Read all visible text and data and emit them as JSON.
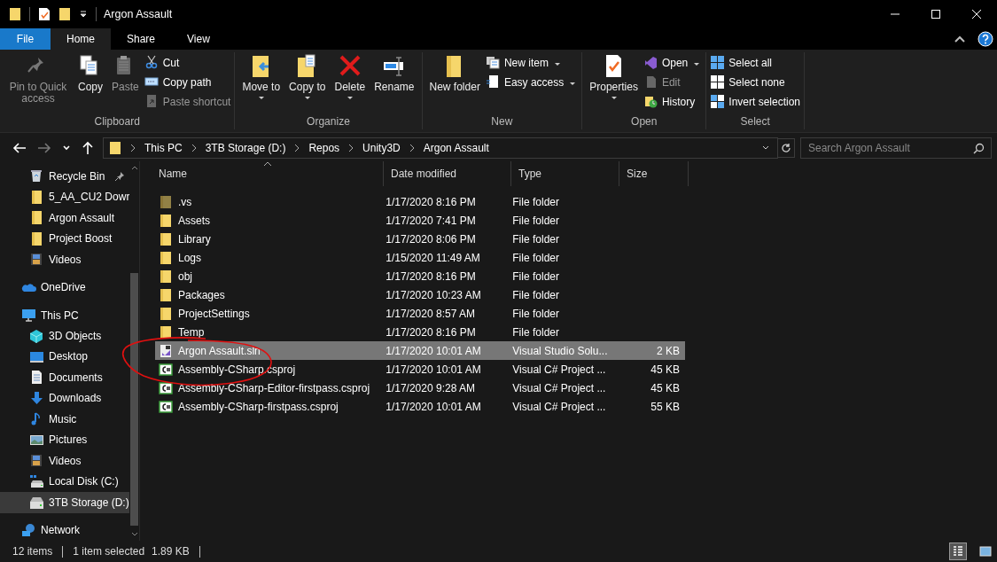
{
  "window": {
    "title": "Argon Assault"
  },
  "tabs": [
    {
      "label": "File",
      "kind": "file",
      "selected": false
    },
    {
      "label": "Home",
      "kind": "tab",
      "selected": true
    },
    {
      "label": "Share",
      "kind": "tab",
      "selected": false
    },
    {
      "label": "View",
      "kind": "tab",
      "selected": false
    }
  ],
  "ribbon": {
    "groups": [
      {
        "label": "Clipboard",
        "items": [
          {
            "label": "Pin to Quick access",
            "kind": "large",
            "disabled": true,
            "dropdown": false
          },
          {
            "label": "Copy",
            "kind": "large",
            "disabled": false,
            "dropdown": false
          },
          {
            "label": "Paste",
            "kind": "large",
            "disabled": true,
            "dropdown": false
          },
          {
            "label": "Cut",
            "kind": "small",
            "disabled": false,
            "dropdown": false
          },
          {
            "label": "Copy path",
            "kind": "small",
            "disabled": false,
            "dropdown": false
          },
          {
            "label": "Paste shortcut",
            "kind": "small",
            "disabled": true,
            "dropdown": false
          }
        ]
      },
      {
        "label": "Organize",
        "items": [
          {
            "label": "Move to",
            "kind": "large",
            "disabled": false,
            "dropdown": true
          },
          {
            "label": "Copy to",
            "kind": "large",
            "disabled": false,
            "dropdown": true
          },
          {
            "label": "Delete",
            "kind": "large",
            "disabled": false,
            "dropdown": true
          },
          {
            "label": "Rename",
            "kind": "large",
            "disabled": false,
            "dropdown": false
          }
        ]
      },
      {
        "label": "New",
        "items": [
          {
            "label": "New folder",
            "kind": "large",
            "disabled": false,
            "dropdown": false
          },
          {
            "label": "New item",
            "kind": "small",
            "disabled": false,
            "dropdown": true
          },
          {
            "label": "Easy access",
            "kind": "small",
            "disabled": false,
            "dropdown": true
          }
        ]
      },
      {
        "label": "Open",
        "items": [
          {
            "label": "Properties",
            "kind": "large",
            "disabled": false,
            "dropdown": true
          },
          {
            "label": "Open",
            "kind": "small",
            "disabled": false,
            "dropdown": true
          },
          {
            "label": "Edit",
            "kind": "small",
            "disabled": true,
            "dropdown": false
          },
          {
            "label": "History",
            "kind": "small",
            "disabled": false,
            "dropdown": false
          }
        ]
      },
      {
        "label": "Select",
        "items": [
          {
            "label": "Select all",
            "kind": "small",
            "disabled": false,
            "dropdown": false
          },
          {
            "label": "Select none",
            "kind": "small",
            "disabled": false,
            "dropdown": false
          },
          {
            "label": "Invert selection",
            "kind": "small",
            "disabled": false,
            "dropdown": false
          }
        ]
      }
    ]
  },
  "address": {
    "forward_disabled": true,
    "path": [
      "This PC",
      "3TB Storage (D:)",
      "Repos",
      "Unity3D",
      "Argon Assault"
    ],
    "search": {
      "placeholder": "Search Argon Assault"
    }
  },
  "sidebar": {
    "quick_access": [
      {
        "label": "Recycle Bin",
        "pinned": true,
        "selected": false
      },
      {
        "label": "5_AA_CU2 Dowr",
        "pinned": false,
        "selected": false
      },
      {
        "label": "Argon Assault",
        "pinned": false,
        "selected": false
      },
      {
        "label": "Project Boost",
        "pinned": false,
        "selected": false
      },
      {
        "label": "Videos",
        "pinned": false,
        "selected": false
      }
    ],
    "items": [
      {
        "label": "OneDrive",
        "selected": false
      },
      {
        "label": "This PC",
        "selected": false,
        "children": [
          {
            "label": "3D Objects",
            "selected": false
          },
          {
            "label": "Desktop",
            "selected": false
          },
          {
            "label": "Documents",
            "selected": false
          },
          {
            "label": "Downloads",
            "selected": false
          },
          {
            "label": "Music",
            "selected": false
          },
          {
            "label": "Pictures",
            "selected": false
          },
          {
            "label": "Videos",
            "selected": false
          },
          {
            "label": "Local Disk (C:)",
            "selected": false
          },
          {
            "label": "3TB Storage (D:)",
            "selected": true
          }
        ]
      },
      {
        "label": "Network",
        "selected": false
      }
    ]
  },
  "table": {
    "columns": [
      "Name",
      "Date modified",
      "Type",
      "Size"
    ],
    "rows": [
      {
        "kind": "folder",
        "hidden": true,
        "selected": false,
        "name": ".vs",
        "date": "1/17/2020 8:16 PM",
        "type": "File folder",
        "size": ""
      },
      {
        "kind": "folder",
        "hidden": false,
        "selected": false,
        "name": "Assets",
        "date": "1/17/2020 7:41 PM",
        "type": "File folder",
        "size": ""
      },
      {
        "kind": "folder",
        "hidden": false,
        "selected": false,
        "name": "Library",
        "date": "1/17/2020 8:06 PM",
        "type": "File folder",
        "size": ""
      },
      {
        "kind": "folder",
        "hidden": false,
        "selected": false,
        "name": "Logs",
        "date": "1/15/2020 11:49 AM",
        "type": "File folder",
        "size": ""
      },
      {
        "kind": "folder",
        "hidden": false,
        "selected": false,
        "name": "obj",
        "date": "1/17/2020 8:16 PM",
        "type": "File folder",
        "size": ""
      },
      {
        "kind": "folder",
        "hidden": false,
        "selected": false,
        "name": "Packages",
        "date": "1/17/2020 10:23 AM",
        "type": "File folder",
        "size": ""
      },
      {
        "kind": "folder",
        "hidden": false,
        "selected": false,
        "name": "ProjectSettings",
        "date": "1/17/2020 8:57 AM",
        "type": "File folder",
        "size": ""
      },
      {
        "kind": "folder",
        "hidden": false,
        "selected": false,
        "name": "Temp",
        "date": "1/17/2020 8:16 PM",
        "type": "File folder",
        "size": ""
      },
      {
        "kind": "solution",
        "hidden": false,
        "selected": true,
        "name": "Argon Assault.sln",
        "date": "1/17/2020 10:01 AM",
        "type": "Visual Studio Solu...",
        "size": "2 KB"
      },
      {
        "kind": "csproj",
        "hidden": false,
        "selected": false,
        "name": "Assembly-CSharp.csproj",
        "date": "1/17/2020 10:01 AM",
        "type": "Visual C# Project ...",
        "size": "45 KB"
      },
      {
        "kind": "csproj",
        "hidden": false,
        "selected": false,
        "name": "Assembly-CSharp-Editor-firstpass.csproj",
        "date": "1/17/2020 9:28 AM",
        "type": "Visual C# Project ...",
        "size": "45 KB"
      },
      {
        "kind": "csproj",
        "hidden": false,
        "selected": false,
        "name": "Assembly-CSharp-firstpass.csproj",
        "date": "1/17/2020 10:01 AM",
        "type": "Visual C# Project ...",
        "size": "55 KB"
      }
    ]
  },
  "status_bar": {
    "count": "12 items",
    "selection": "1 item selected",
    "size": "1.89 KB",
    "views": [
      {
        "kind": "details",
        "selected": true
      },
      {
        "kind": "large-icons",
        "selected": false
      }
    ]
  }
}
